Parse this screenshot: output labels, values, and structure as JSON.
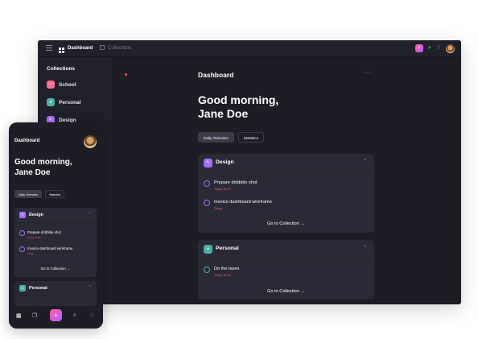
{
  "colors": {
    "school": "#ff6b8b",
    "personal": "#49b3a8",
    "design": "#a86bff",
    "accent_gradient": "#ff5fa8",
    "task_time": "#ff5a7a"
  },
  "desktop": {
    "topbar": {
      "menu_icon": "hamburger-icon",
      "dashboard_label": "Dashboard",
      "collections_label": "Collections"
    },
    "sidebar": {
      "title": "Collections",
      "items": [
        {
          "label": "School",
          "icon": "school-icon",
          "color": "#ff6b8b"
        },
        {
          "label": "Personal",
          "icon": "person-icon",
          "color": "#49b3a8"
        },
        {
          "label": "Design",
          "icon": "pen-icon",
          "color": "#a86bff"
        }
      ]
    },
    "main": {
      "title": "Dashboard",
      "more": "···",
      "greeting_line1": "Good morning,",
      "greeting_line2": "Jane Doe",
      "tabs": [
        "Daily Overview",
        "Statistics"
      ],
      "cards": [
        {
          "title": "Design",
          "tasks": [
            {
              "text": "Prepare dribbble shot",
              "time": "Today 13:00"
            },
            {
              "text": "Invoice dashboard wireframe",
              "time": "Today"
            }
          ],
          "goto": "Go to Collection →"
        },
        {
          "title": "Personal",
          "tasks": [
            {
              "text": "Do the taxes",
              "time": "Today 16:00"
            }
          ],
          "goto": "Go to Collection →"
        }
      ]
    }
  },
  "mobile": {
    "title": "Dashboard",
    "greeting_line1": "Good morning,",
    "greeting_line2": "Jane Doe",
    "tabs": [
      "Daily Overview",
      "Statistics"
    ],
    "cards": [
      {
        "title": "Design",
        "tasks": [
          {
            "text": "Prepare dribbble shot",
            "time": "Today 13:00"
          },
          {
            "text": "Invoice dashboard wireframe",
            "time": "Today"
          }
        ],
        "goto": "Go to Collection →"
      },
      {
        "title": "Personal"
      }
    ]
  }
}
